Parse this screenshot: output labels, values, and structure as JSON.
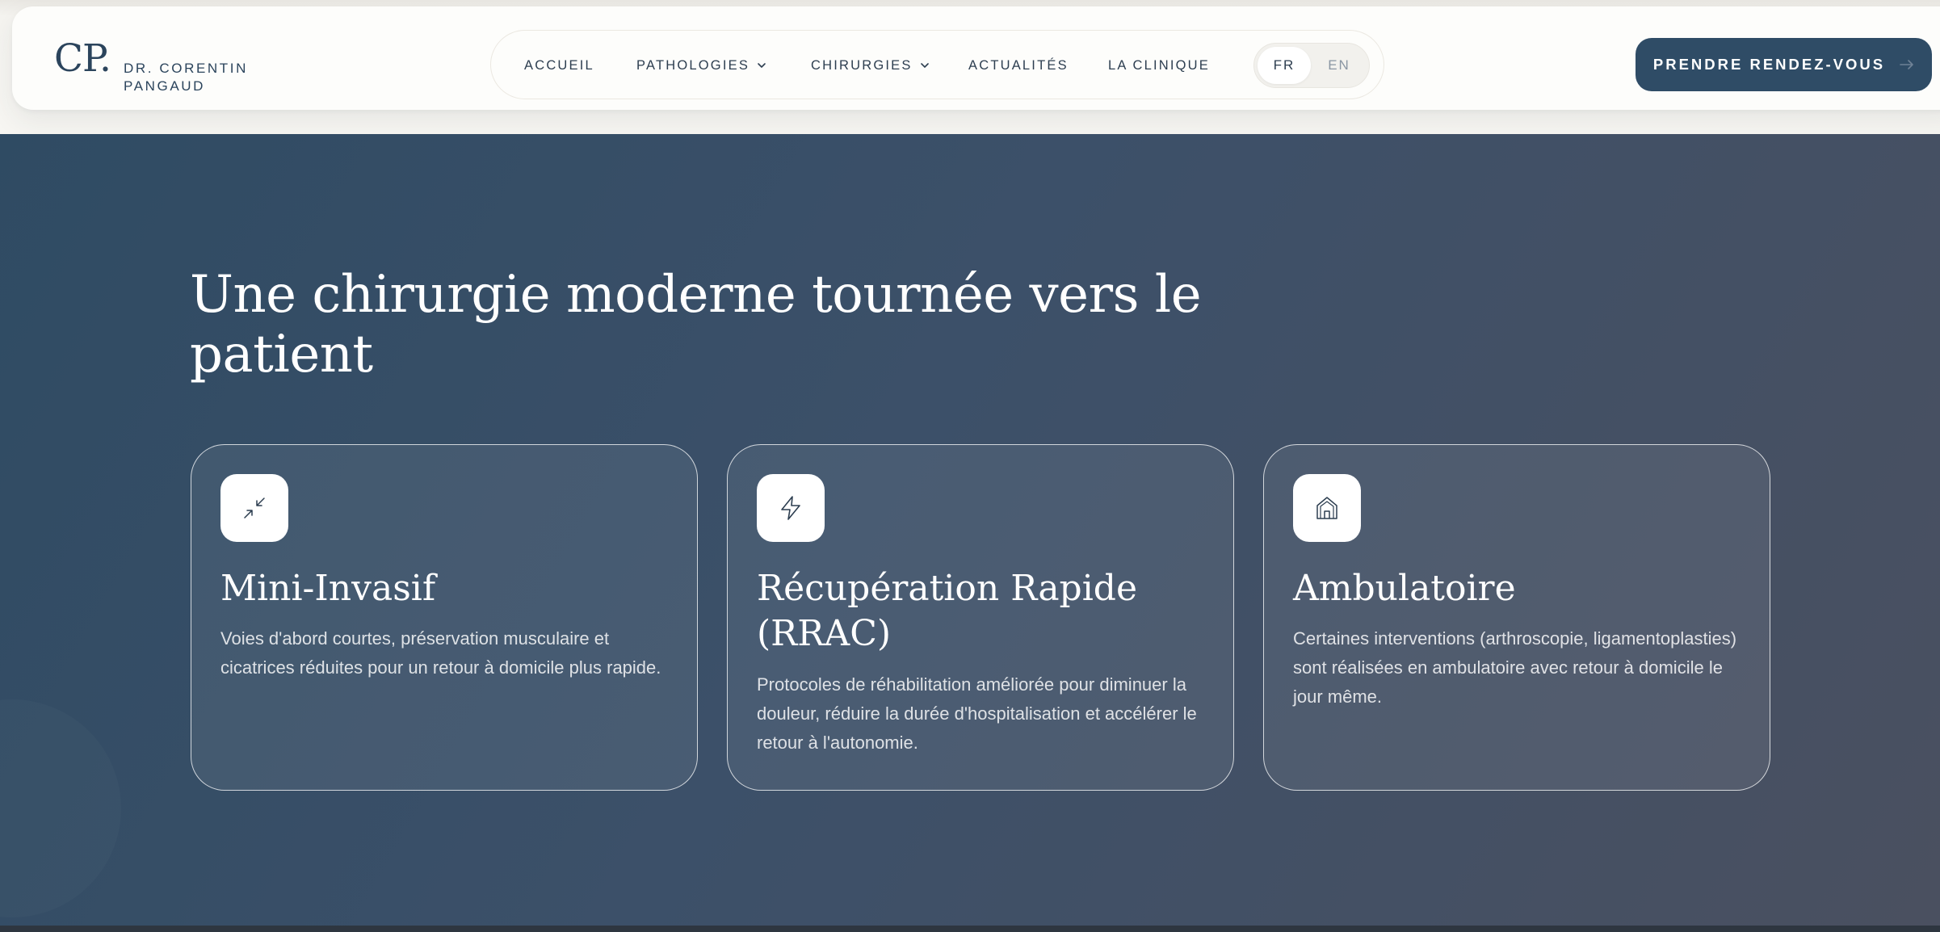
{
  "header": {
    "logo_mark": "CP.",
    "logo_name_line1": "DR. CORENTIN",
    "logo_name_line2": "PANGAUD",
    "nav": [
      {
        "label": "ACCUEIL",
        "dropdown": false
      },
      {
        "label": "PATHOLOGIES",
        "dropdown": true
      },
      {
        "label": "CHIRURGIES",
        "dropdown": true
      },
      {
        "label": "ACTUALITÉS",
        "dropdown": false
      },
      {
        "label": "LA CLINIQUE",
        "dropdown": false
      }
    ],
    "languages": [
      {
        "label": "FR",
        "active": true
      },
      {
        "label": "EN",
        "active": false
      }
    ],
    "cta_label": "PRENDRE RENDEZ-VOUS"
  },
  "hero": {
    "title": "Une chirurgie moderne tournée vers le patient",
    "cards": [
      {
        "icon": "compress-arrows-icon",
        "title": "Mini-Invasif",
        "text": "Voies d'abord courtes, préservation musculaire et cicatrices réduites pour un retour à domicile plus rapide."
      },
      {
        "icon": "lightning-icon",
        "title": "Récupération Rapide (RRAC)",
        "text": "Protocoles de réhabilitation améliorée pour diminuer la douleur, réduire la durée d'hospitalisation et accélérer le retour à l'autonomie."
      },
      {
        "icon": "home-icon",
        "title": "Ambulatoire",
        "text": "Certaines interventions (arthroscopie, ligamentoplasties) sont réalisées en ambulatoire avec retour à domicile le jour même."
      }
    ]
  },
  "colors": {
    "brand_navy": "#2f4c66",
    "text_dark": "#2d3e50",
    "hero_gradient_start": "#2f4b63",
    "hero_gradient_end": "#4a5060",
    "header_bg": "#fdfdfb"
  }
}
